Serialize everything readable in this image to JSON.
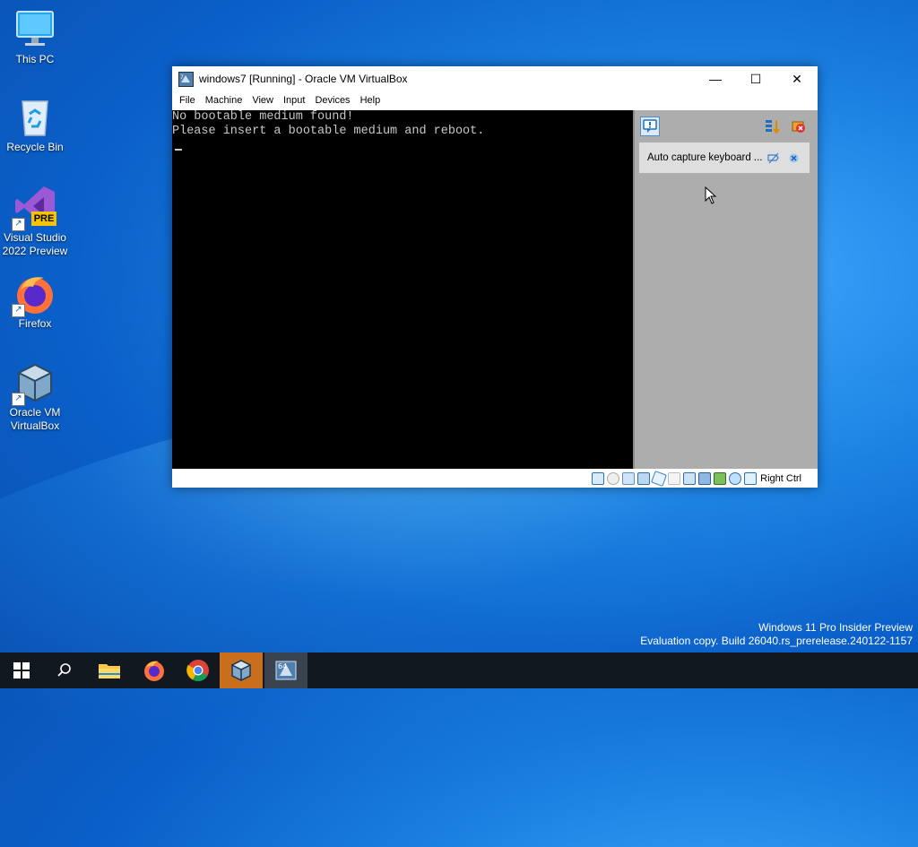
{
  "desktop": {
    "icons": [
      {
        "label": "This PC"
      },
      {
        "label": "Recycle Bin"
      },
      {
        "label": "Visual Studio 2022 Preview",
        "badge": "PRE"
      },
      {
        "label": "Firefox"
      },
      {
        "label": "Oracle VM VirtualBox"
      }
    ]
  },
  "window": {
    "title": "windows7 [Running] - Oracle VM VirtualBox",
    "minimize": "—",
    "maximize": "☐",
    "close": "✕",
    "menu": [
      "File",
      "Machine",
      "View",
      "Input",
      "Devices",
      "Help"
    ],
    "screen_lines": [
      "No bootable medium found!",
      "Please insert a bootable medium and reboot."
    ],
    "notification": "Auto capture keyboard ...",
    "host_key": "Right Ctrl"
  },
  "watermark": {
    "line1": "Windows 11 Pro Insider Preview",
    "line2": "Evaluation copy. Build 26040.rs_prerelease.240122-1157"
  },
  "colors": {
    "accent": "#c96f1b",
    "taskbar": "#111820",
    "vm_screen": "#000000"
  }
}
